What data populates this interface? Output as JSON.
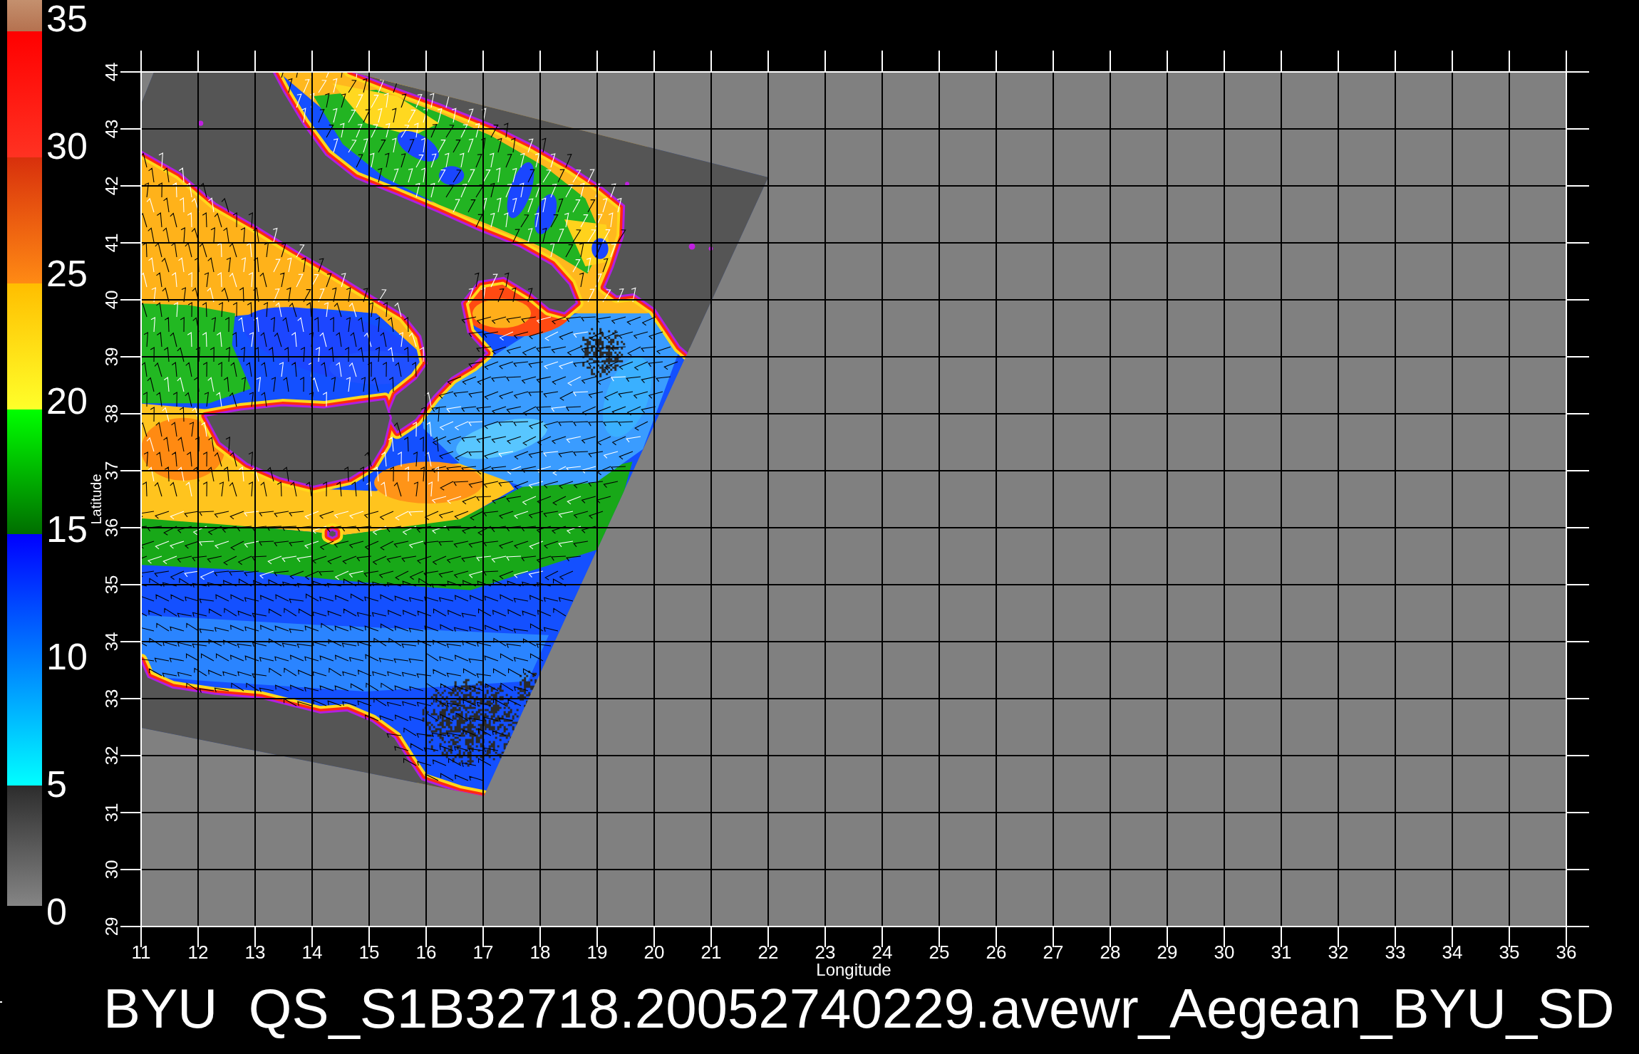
{
  "color_scale": {
    "labels": [
      "35",
      "30",
      "25",
      "20",
      "15",
      "10",
      "5",
      "0"
    ]
  },
  "map": {
    "x_axis": {
      "title": "Longitude",
      "ticks": [
        "11",
        "12",
        "13",
        "14",
        "15",
        "16",
        "17",
        "18",
        "19",
        "20",
        "21",
        "22",
        "23",
        "24",
        "25",
        "26",
        "27",
        "28",
        "29",
        "30",
        "31",
        "32",
        "33",
        "34",
        "35",
        "36"
      ]
    },
    "y_axis": {
      "title": "Latitude",
      "ticks": [
        "29",
        "30",
        "31",
        "32",
        "33",
        "34",
        "35",
        "36",
        "37",
        "38",
        "39",
        "40",
        "41",
        "42",
        "43",
        "44"
      ]
    }
  },
  "title": "BYU  QS_S1B32718.20052740229.avewr_Aegean_BYU_SD"
}
